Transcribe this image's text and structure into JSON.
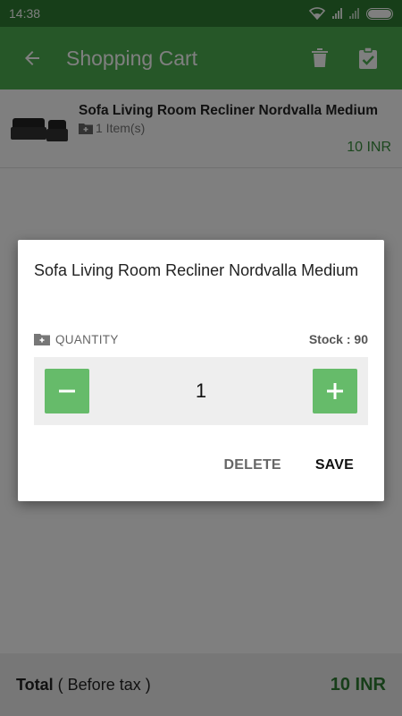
{
  "status_bar": {
    "time": "14:38"
  },
  "toolbar": {
    "title": "Shopping Cart",
    "back_icon": "arrow-back-icon",
    "delete_icon": "trash-icon",
    "checkout_icon": "clipboard-check-icon"
  },
  "cart": {
    "items": [
      {
        "name": "Sofa Living Room Recliner Nordvalla Medium",
        "count": "1 Item(s)",
        "price": "10 INR"
      }
    ]
  },
  "footer": {
    "total_label": "Total",
    "total_note": " ( Before tax )",
    "total_value": "10 INR"
  },
  "dialog": {
    "title": "Sofa Living Room Recliner Nordvalla Medium",
    "quantity_label": "QUANTITY",
    "stock_label": "Stock :",
    "stock_value": "90",
    "quantity": "1",
    "delete_label": "DELETE",
    "save_label": "SAVE"
  },
  "colors": {
    "primary": "#4caf50",
    "primary_dark": "#2e7d32",
    "price": "#388e3c",
    "stepper_button": "#66bb6a"
  }
}
